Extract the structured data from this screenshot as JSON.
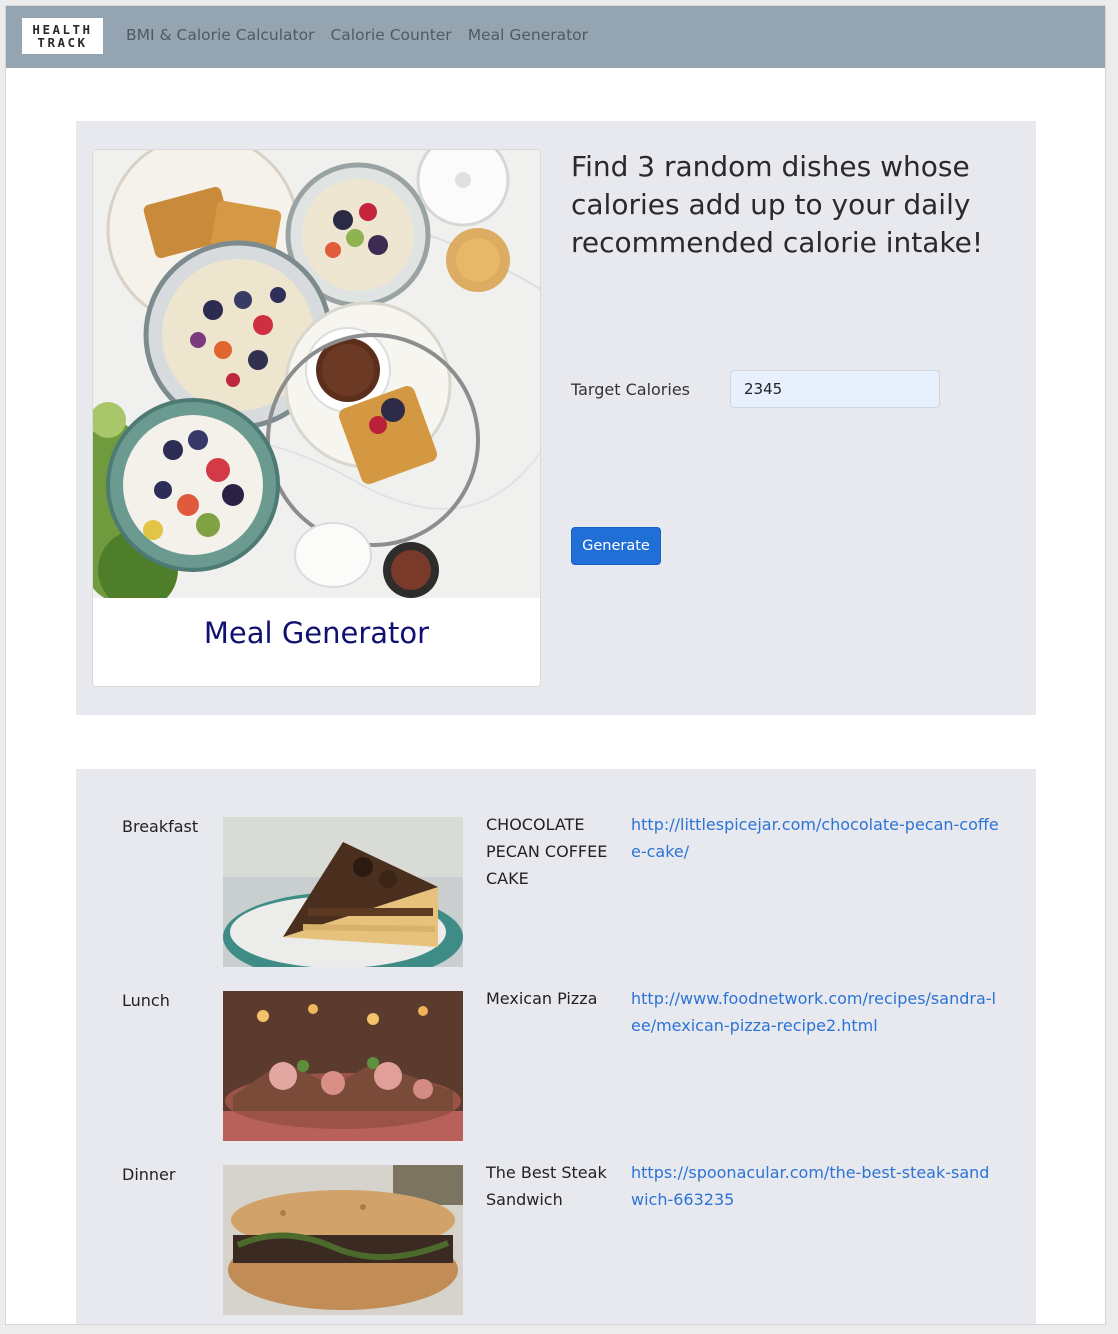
{
  "navbar": {
    "logo_line1": "HEALTH",
    "logo_line2": "TRACK",
    "links": [
      "BMI & Calorie Calculator",
      "Calorie Counter",
      "Meal Generator"
    ]
  },
  "hero": {
    "card_title": "Meal Generator",
    "description": "Find 3 random dishes whose calories add up to your daily recommended calorie intake!",
    "target_label": "Target Calories",
    "target_value": "2345",
    "generate_label": "Generate"
  },
  "meals": [
    {
      "type": "Breakfast",
      "name": "CHOCOLATE PECAN COFFEE CAKE",
      "url": "http://littlespicejar.com/chocolate-pecan-coffee-cake/"
    },
    {
      "type": "Lunch",
      "name": "Mexican Pizza",
      "url": "http://www.foodnetwork.com/recipes/sandra-lee/mexican-pizza-recipe2.html"
    },
    {
      "type": "Dinner",
      "name": "The Best Steak Sandwich",
      "url": "https://spoonacular.com/the-best-steak-sandwich-663235"
    }
  ],
  "colors": {
    "navbar": "#95a4b1",
    "panel": "#e8e9ee",
    "primary_button": "#1f6fd7",
    "link": "#2b73d6",
    "card_title": "#101073"
  }
}
